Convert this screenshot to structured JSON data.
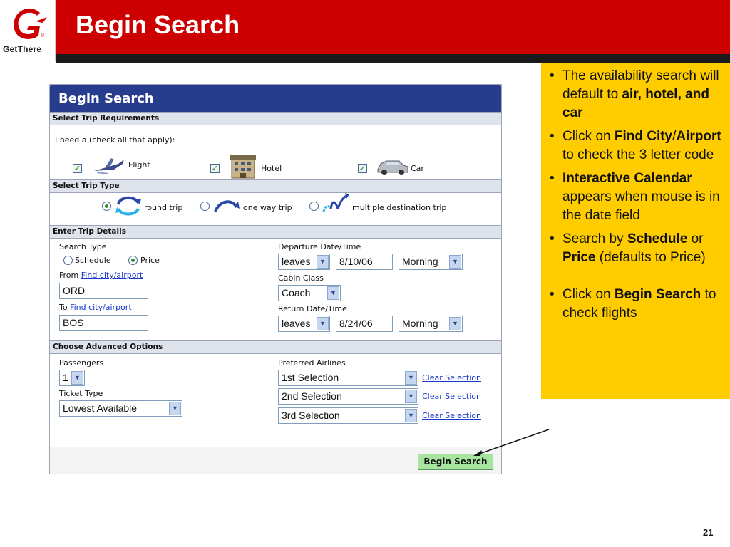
{
  "header": {
    "logo_text": "GetThere",
    "title": "Begin Search"
  },
  "form": {
    "title": "Begin Search",
    "trip_requirements": {
      "heading": "Select Trip Requirements",
      "prompt": "I need a (check all that apply):",
      "options": [
        {
          "label": "Flight",
          "checked": true,
          "icon": "airplane-icon"
        },
        {
          "label": "Hotel",
          "checked": true,
          "icon": "hotel-icon"
        },
        {
          "label": "Car",
          "checked": true,
          "icon": "car-icon"
        }
      ]
    },
    "trip_type": {
      "heading": "Select Trip Type",
      "options": [
        {
          "label": "round trip",
          "selected": true
        },
        {
          "label": "one way trip",
          "selected": false
        },
        {
          "label": "multiple destination trip",
          "selected": false
        }
      ]
    },
    "trip_details": {
      "heading": "Enter Trip Details",
      "search_type_label": "Search Type",
      "search_type_options": [
        {
          "label": "Schedule",
          "selected": false
        },
        {
          "label": "Price",
          "selected": true
        }
      ],
      "from_label": "From",
      "from_link": "Find city/airport",
      "from_value": "ORD",
      "to_label": "To",
      "to_link": "Find city/airport",
      "to_value": "BOS",
      "departure_label": "Departure Date/Time",
      "departure_mode": "leaves",
      "departure_date": "8/10/06",
      "departure_time": "Morning",
      "cabin_label": "Cabin Class",
      "cabin_value": "Coach",
      "return_label": "Return Date/Time",
      "return_mode": "leaves",
      "return_date": "8/24/06",
      "return_time": "Morning"
    },
    "advanced": {
      "heading": "Choose Advanced Options",
      "passengers_label": "Passengers",
      "passengers_value": "1",
      "ticket_type_label": "Ticket Type",
      "ticket_type_value": "Lowest Available",
      "airlines_label": "Preferred Airlines",
      "airlines": [
        {
          "value": "1st Selection",
          "clear": "Clear Selection"
        },
        {
          "value": "2nd Selection",
          "clear": "Clear Selection"
        },
        {
          "value": "3rd Selection",
          "clear": "Clear Selection"
        }
      ]
    },
    "begin_button": "Begin Search"
  },
  "notes": {
    "n1_a": "The availability search will default to ",
    "n1_b": "air, hotel, and car",
    "n2_a": "Click on ",
    "n2_b": "Find City",
    "n2_c": "/",
    "n2_d": "Airport",
    "n2_e": " to check the 3 letter code",
    "n3_a": "Interactive Calendar",
    "n3_b": " appears when mouse is in the date field",
    "n4_a": "Search by ",
    "n4_b": "Schedule",
    "n4_c": " or ",
    "n4_d": "Price",
    "n4_e": " (defaults to Price)",
    "n5_a": "Click on ",
    "n5_b": "Begin Search",
    "n5_c": " to check flights"
  },
  "page_number": "21",
  "colors": {
    "header_red": "#cc0000",
    "panel_title_blue": "#283c8e",
    "note_yellow": "#ffcc00",
    "button_green": "#a8e6a0"
  }
}
